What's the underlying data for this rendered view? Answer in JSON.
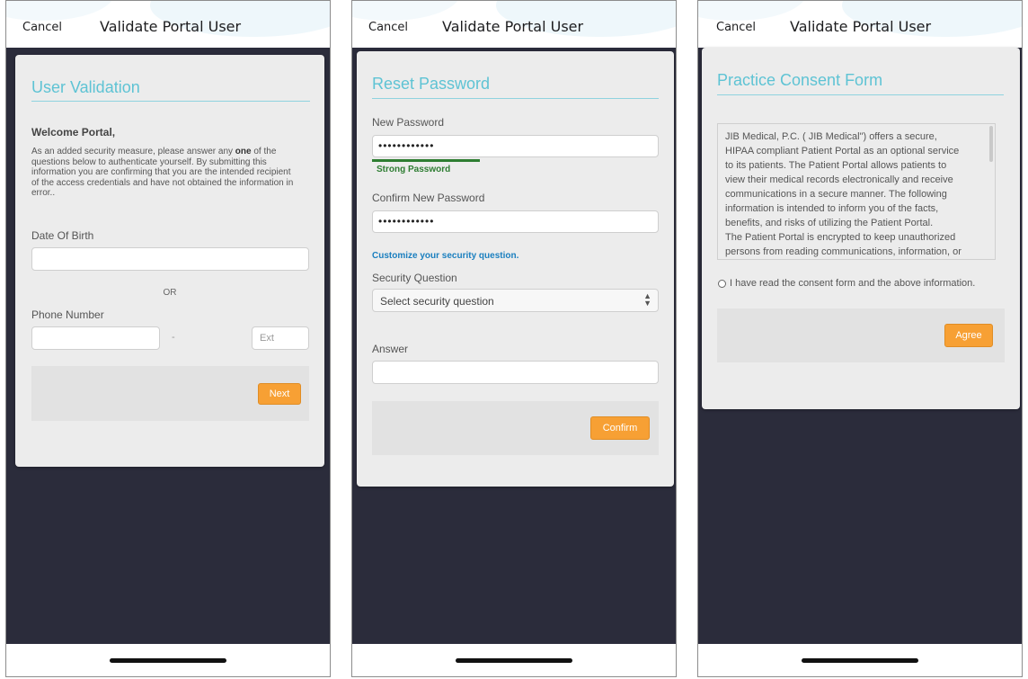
{
  "phone1": {
    "cancel": "Cancel",
    "title": "Validate Portal User",
    "card_title": "User Validation",
    "welcome": "Welcome Portal,",
    "instr_lines": [
      "As an added security measure, please answer any",
      "one",
      "of the",
      "questions below to authenticate yourself. By submitting this",
      "information you are confirming that you are the intended recipient",
      "of the access credentials and have not obtained the information in",
      "error.."
    ],
    "dob_label": "Date Of Birth",
    "or_text": "OR",
    "phone_label": "Phone Number",
    "dash": "-",
    "ext_placeholder": "Ext",
    "next_button": "Next"
  },
  "phone2": {
    "cancel": "Cancel",
    "title": "Validate Portal User",
    "card_title": "Reset Password",
    "new_pw_label": "New Password",
    "new_pw_value": "••••••••••••",
    "strength_text": "Strong Password",
    "confirm_label": "Confirm New Password",
    "confirm_value": "••••••••••••",
    "customize_link": "Customize your security question.",
    "sq_label": "Security Question",
    "sq_select": "Select security question",
    "answer_label": "Answer",
    "confirm_button": "Confirm"
  },
  "phone3": {
    "cancel": "Cancel",
    "title": "Validate Portal User",
    "card_title": "Practice Consent Form",
    "consent_lines": [
      "JIB Medical, P.C. ( JIB Medical\") offers a secure,",
      "HIPAA compliant Patient Portal as an optional service",
      "to its patients. The Patient Portal allows patients to",
      "view their medical records electronically and receive",
      "communications in a secure manner. The following",
      "information is intended to inform you of the facts,",
      "benefits, and risks of utilizing the Patient Portal.",
      "The Patient Portal is encrypted to keep unauthorized",
      "persons from reading communications, information, or"
    ],
    "checkbox_label": "I have read the consent form and the above information.",
    "agree_button": "Agree"
  },
  "colors": {
    "accent": "#5ec3d4",
    "button": "#f7a034",
    "strength": "#2e7d32",
    "link": "#1a7fbf",
    "background": "#2b2c3b"
  }
}
